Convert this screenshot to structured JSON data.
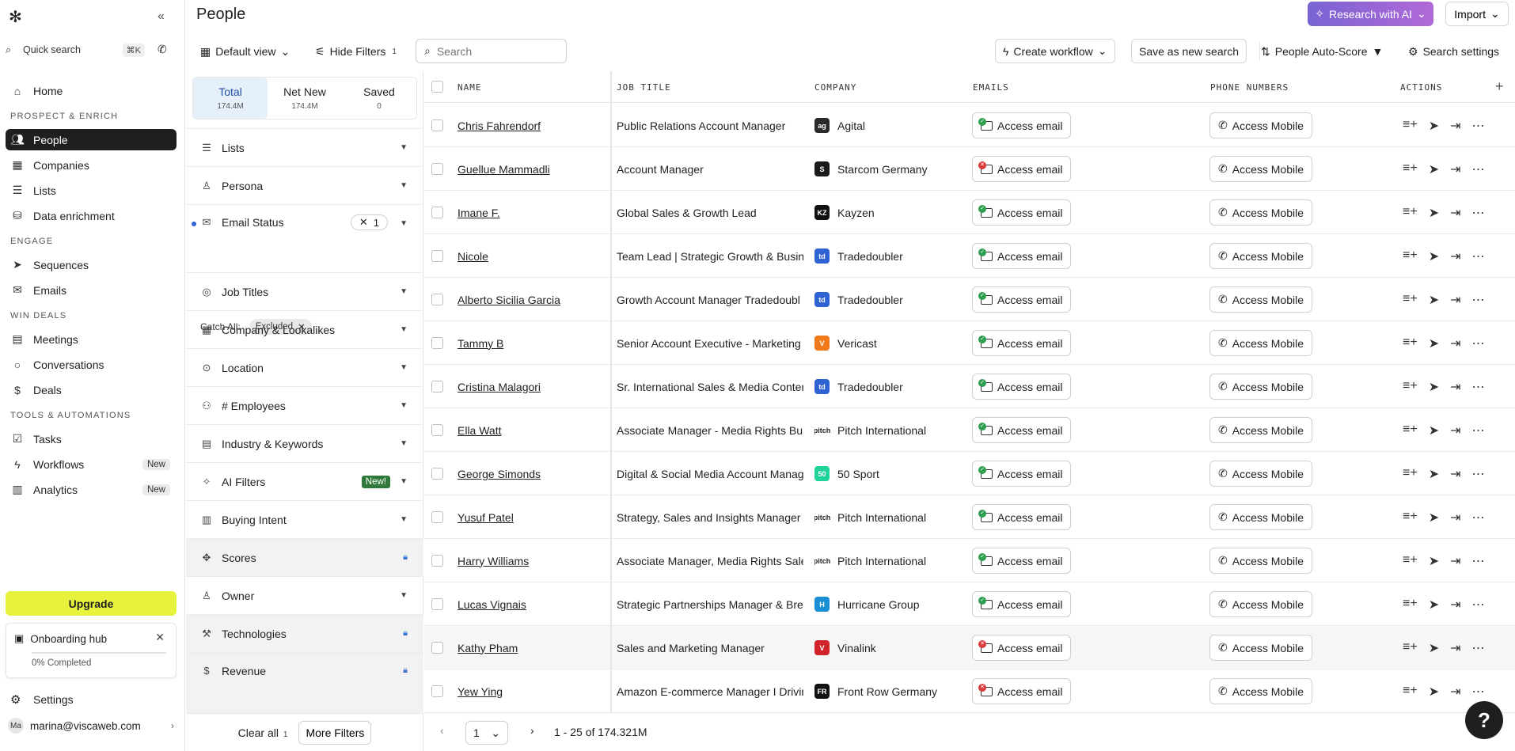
{
  "sidebar": {
    "quick_search": "Quick search",
    "shortcut": "⌘K",
    "nav": [
      {
        "label": "Home"
      },
      {
        "label": "People"
      },
      {
        "label": "Companies"
      },
      {
        "label": "Lists"
      },
      {
        "label": "Data enrichment"
      },
      {
        "label": "Sequences"
      },
      {
        "label": "Emails"
      },
      {
        "label": "Meetings"
      },
      {
        "label": "Conversations"
      },
      {
        "label": "Deals"
      },
      {
        "label": "Tasks"
      },
      {
        "label": "Workflows",
        "badge": "New"
      },
      {
        "label": "Analytics",
        "badge": "New"
      }
    ],
    "sections": [
      "PROSPECT & ENRICH",
      "ENGAGE",
      "WIN DEALS",
      "TOOLS & AUTOMATIONS"
    ],
    "upgrade": "Upgrade",
    "onboarding": {
      "title": "Onboarding hub",
      "progress": "0% Completed",
      "percent": 0
    },
    "settings": "Settings",
    "user": {
      "initials": "Ma",
      "email": "marina@viscaweb.com"
    }
  },
  "header": {
    "title": "People",
    "research": "Research with AI",
    "import": "Import",
    "default_view": "Default view",
    "hide_filters": "Hide Filters",
    "hide_filters_count": "1",
    "search_placeholder": "Search",
    "create_workflow": "Create workflow",
    "save_search": "Save as new search",
    "auto_score": "People Auto-Score",
    "search_settings": "Search settings"
  },
  "filters": {
    "tabs": [
      {
        "label": "Total",
        "count": "174.4M"
      },
      {
        "label": "Net New",
        "count": "174.4M"
      },
      {
        "label": "Saved",
        "count": "0"
      }
    ],
    "items": [
      {
        "label": "Lists"
      },
      {
        "label": "Persona"
      },
      {
        "label": "Email Status",
        "count": "1"
      },
      {
        "label": "Job Titles"
      },
      {
        "label": "Company & Lookalikes"
      },
      {
        "label": "Location"
      },
      {
        "label": "# Employees"
      },
      {
        "label": "Industry & Keywords"
      },
      {
        "label": "AI Filters",
        "badge": "New!"
      },
      {
        "label": "Buying Intent"
      },
      {
        "label": "Scores"
      },
      {
        "label": "Owner"
      },
      {
        "label": "Technologies"
      },
      {
        "label": "Revenue"
      }
    ],
    "catch_all_label": "Catch All:",
    "catch_all_value": "Excluded",
    "clear_all": "Clear all",
    "clear_count": "1",
    "more_filters": "More Filters"
  },
  "table": {
    "columns": [
      "NAME",
      "JOB TITLE",
      "COMPANY",
      "EMAILS",
      "PHONE NUMBERS",
      "ACTIONS"
    ],
    "email_button": "Access email",
    "mobile_button": "Access Mobile",
    "rows": [
      {
        "name": "Chris Fahrendorf",
        "title": "Public Relations Account Manager",
        "company": "Agital",
        "email_ok": true
      },
      {
        "name": "Guellue Mammadli",
        "title": "Account Manager",
        "company": "Starcom Germany",
        "email_ok": false
      },
      {
        "name": "Imane F.",
        "title": "Global Sales & Growth Lead",
        "company": "Kayzen",
        "email_ok": true
      },
      {
        "name": "Nicole",
        "title": "Team Lead | Strategic Growth & Busin",
        "company": "Tradedoubler",
        "email_ok": true
      },
      {
        "name": "Alberto Sicilia Garcia",
        "title": "Growth Account Manager Tradedoubl",
        "company": "Tradedoubler",
        "email_ok": true
      },
      {
        "name": "Tammy B",
        "title": "Senior Account Executive - Marketing",
        "company": "Vericast",
        "email_ok": true
      },
      {
        "name": "Cristina Malagori",
        "title": "Sr. International Sales & Media Conter",
        "company": "Tradedoubler",
        "email_ok": true
      },
      {
        "name": "Ella Watt",
        "title": "Associate Manager - Media Rights Bu",
        "company": "Pitch International",
        "email_ok": true
      },
      {
        "name": "George Simonds",
        "title": "Digital & Social Media Account Manag",
        "company": "50 Sport",
        "email_ok": true
      },
      {
        "name": "Yusuf Patel",
        "title": "Strategy, Sales and Insights Manager",
        "company": "Pitch International",
        "email_ok": true
      },
      {
        "name": "Harry Williams",
        "title": "Associate Manager, Media Rights Sale",
        "company": "Pitch International",
        "email_ok": true
      },
      {
        "name": "Lucas Vignais",
        "title": "Strategic Partnerships Manager & Bre",
        "company": "Hurricane Group",
        "email_ok": true
      },
      {
        "name": "Kathy Pham",
        "title": "Sales and Marketing Manager",
        "company": "Vinalink",
        "email_ok": false
      },
      {
        "name": "Yew Ying",
        "title": "Amazon E-commerce Manager I Drivir",
        "company": "Front Row Germany",
        "email_ok": false
      }
    ]
  },
  "pagination": {
    "page": "1",
    "range": "1 - 25 of 174.321M"
  },
  "colors": {
    "accent": "#2f62d3",
    "upgrade": "#e6f23c",
    "ok": "#2e9e4f",
    "bad": "#d93a3a"
  }
}
